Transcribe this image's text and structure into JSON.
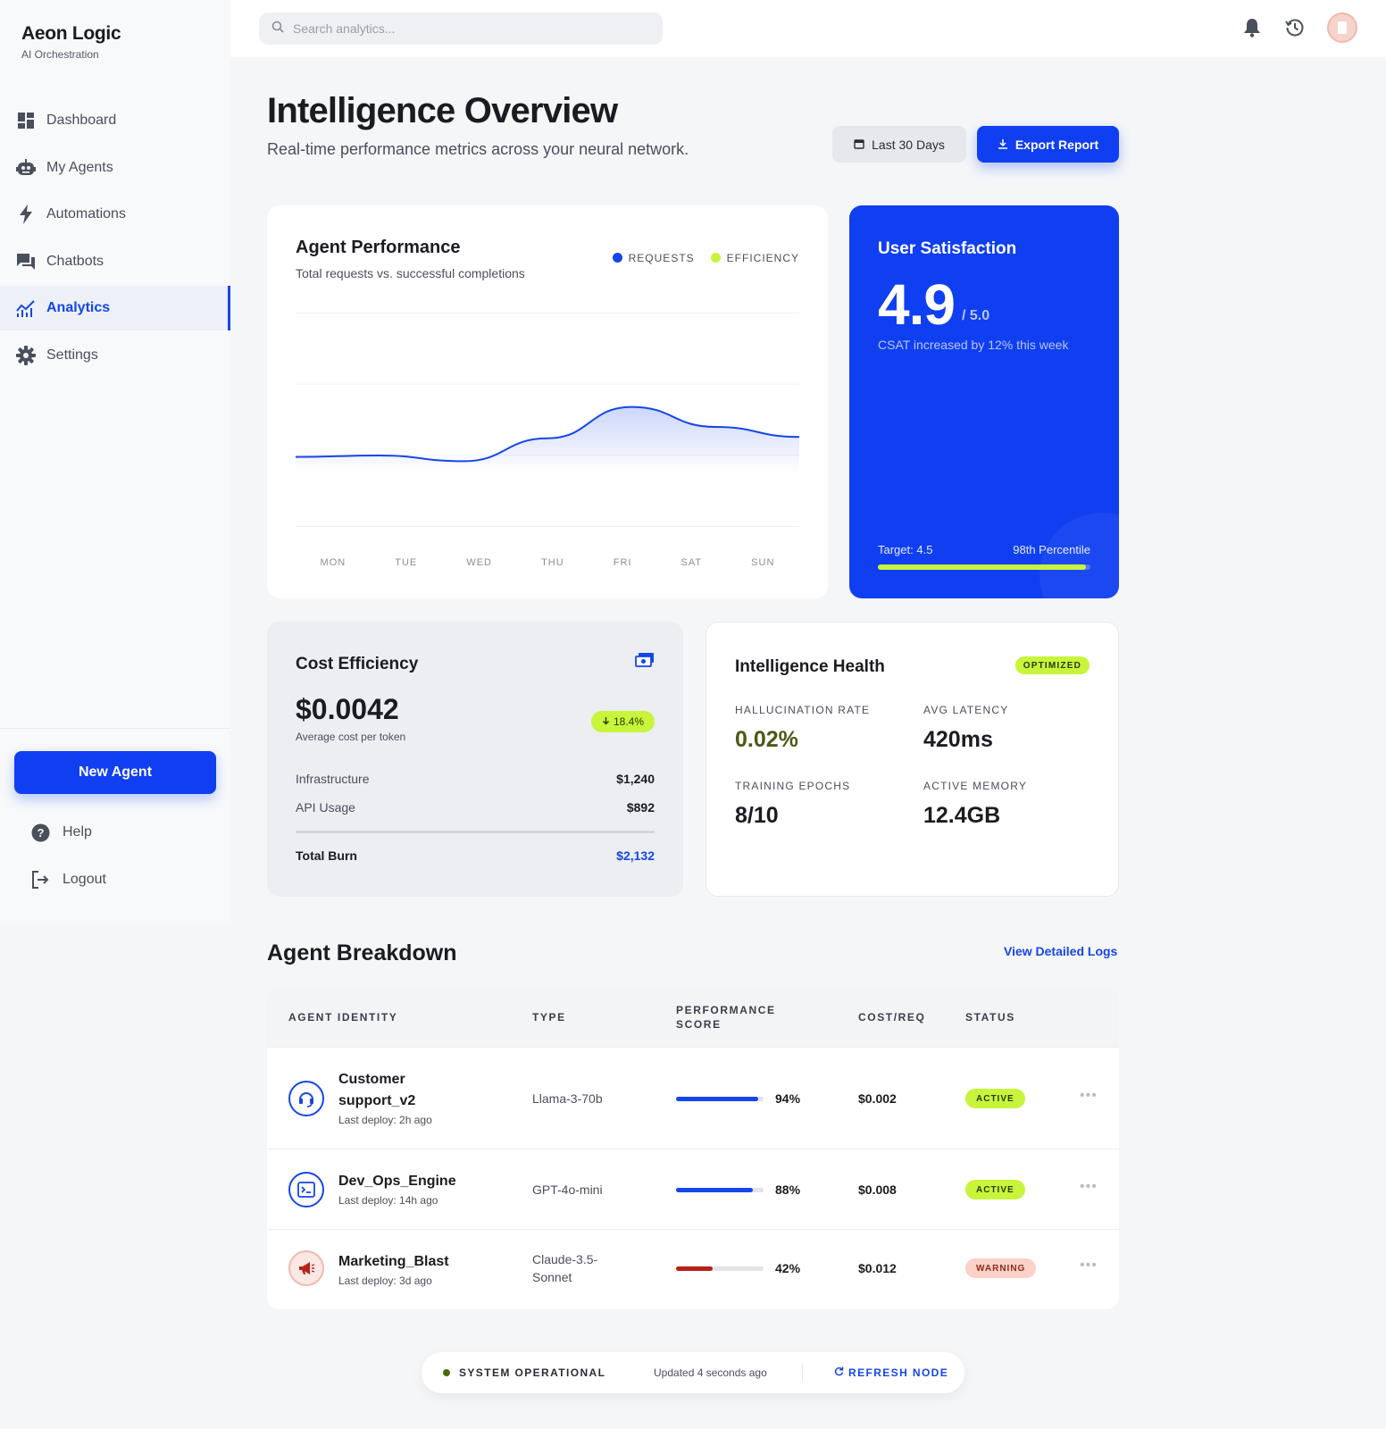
{
  "brand": {
    "name": "Aeon Logic",
    "tagline": "AI Orchestration"
  },
  "nav": [
    {
      "label": "Dashboard",
      "icon": "dashboard-icon"
    },
    {
      "label": "My Agents",
      "icon": "robot-icon"
    },
    {
      "label": "Automations",
      "icon": "bolt-icon"
    },
    {
      "label": "Chatbots",
      "icon": "chat-icon"
    },
    {
      "label": "Analytics",
      "icon": "analytics-icon",
      "active": true
    },
    {
      "label": "Settings",
      "icon": "gear-icon"
    }
  ],
  "sidebar_actions": {
    "new_agent": "New Agent",
    "help": "Help",
    "logout": "Logout"
  },
  "search": {
    "placeholder": "Search analytics..."
  },
  "header": {
    "title": "Intelligence Overview",
    "subtitle": "Real-time performance metrics across your neural network.",
    "range_label": "Last 30 Days",
    "export_label": "Export Report"
  },
  "performance": {
    "title": "Agent Performance",
    "subtitle": "Total requests vs. successful completions",
    "legend": [
      {
        "label": "REQUESTS",
        "color": "#1546e8"
      },
      {
        "label": "EFFICIENCY",
        "color": "#c8f53c"
      }
    ]
  },
  "chart_data": {
    "type": "area",
    "title": "Agent Performance",
    "categories": [
      "MON",
      "TUE",
      "WED",
      "THU",
      "FRI",
      "SAT",
      "SUN"
    ],
    "series": [
      {
        "name": "REQUESTS",
        "values": [
          49,
          50,
          46,
          62,
          84,
          70,
          63
        ]
      }
    ],
    "ylim": [
      0,
      150
    ],
    "grid": true,
    "legend_position": "top-right"
  },
  "satisfaction": {
    "title": "User Satisfaction",
    "score": "4.9",
    "max": "/ 5.0",
    "note": "CSAT increased by 12% this week",
    "target": "Target: 4.5",
    "percentile": "98th Percentile",
    "progress": 0.98
  },
  "cost": {
    "title": "Cost Efficiency",
    "value": "$0.0042",
    "value_label": "Average cost per token",
    "badge": "18.4%",
    "rows": [
      {
        "label": "Infrastructure",
        "value": "$1,240"
      },
      {
        "label": "API Usage",
        "value": "$892"
      }
    ],
    "total_label": "Total Burn",
    "total_value": "$2,132"
  },
  "health": {
    "title": "Intelligence Health",
    "badge": "OPTIMIZED",
    "metrics": [
      {
        "label": "HALLUCINATION RATE",
        "value": "0.02%"
      },
      {
        "label": "AVG LATENCY",
        "value": "420ms"
      },
      {
        "label": "TRAINING EPOCHS",
        "value": "8/10"
      },
      {
        "label": "ACTIVE MEMORY",
        "value": "12.4GB"
      }
    ]
  },
  "breakdown": {
    "title": "Agent Breakdown",
    "link": "View Detailed Logs",
    "columns": [
      "AGENT IDENTITY",
      "TYPE",
      "PERFORMANCE",
      "SCORE",
      "COST/REQ",
      "STATUS"
    ],
    "rows": [
      {
        "name_line1": "Customer",
        "name_line2": "support_v2",
        "deploy": "Last deploy: 2h ago",
        "type": "Llama-3-70b",
        "score": "94%",
        "score_value": 94,
        "cost": "$0.002",
        "status": "ACTIVE",
        "icon": "headset-icon"
      },
      {
        "name": "Dev_Ops_Engine",
        "deploy": "Last deploy: 14h ago",
        "type": "GPT-4o-mini",
        "score": "88%",
        "score_value": 88,
        "cost": "$0.008",
        "status": "ACTIVE",
        "icon": "terminal-icon"
      },
      {
        "name": "Marketing_Blast",
        "deploy": "Last deploy: 3d ago",
        "type_line1": "Claude-3.5-",
        "type_line2": "Sonnet",
        "score": "42%",
        "score_value": 42,
        "cost": "$0.012",
        "status": "WARNING",
        "icon": "megaphone-icon"
      }
    ]
  },
  "footer": {
    "status": "SYSTEM OPERATIONAL",
    "updated": "Updated 4 seconds ago",
    "refresh": "REFRESH NODE"
  }
}
